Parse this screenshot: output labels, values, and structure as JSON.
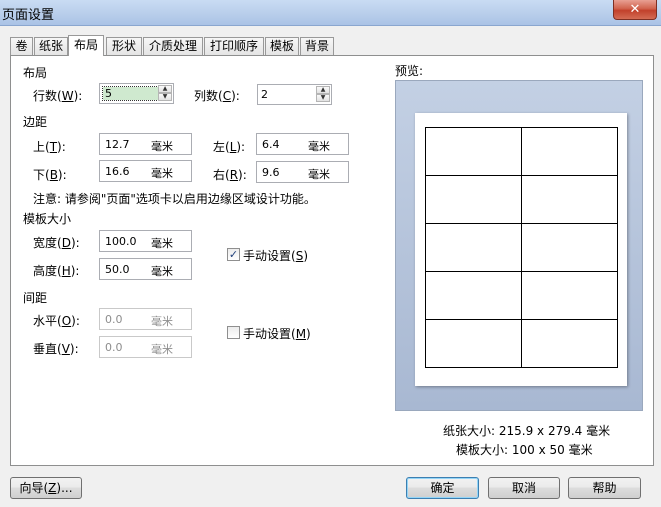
{
  "window": {
    "title": "页面设置",
    "close_glyph": "✕"
  },
  "tabs": [
    "卷",
    "纸张",
    "布局",
    "形状",
    "介质处理",
    "打印顺序",
    "模板",
    "背景"
  ],
  "layout_section": {
    "label": "布局",
    "rows_label": "行数(",
    "rows_key": "W",
    "rows_suffix": "):",
    "rows_value": "5",
    "cols_label": "列数(",
    "cols_key": "C",
    "cols_suffix": "):",
    "cols_value": "2"
  },
  "margin_section": {
    "label": "边距",
    "top_label": "上(",
    "top_key": "T",
    "top_suffix": "):",
    "top_value": "12.7",
    "top_unit": "毫米",
    "left_label": "左(",
    "left_key": "L",
    "left_suffix": "):",
    "left_value": "6.4",
    "left_unit": "毫米",
    "bottom_label": "下(",
    "bottom_key": "B",
    "bottom_suffix": "):",
    "bottom_value": "16.6",
    "bottom_unit": "毫米",
    "right_label": "右(",
    "right_key": "R",
    "right_suffix": "):",
    "right_value": "9.6",
    "right_unit": "毫米",
    "note": "注意: 请参阅\"页面\"选项卡以启用边缘区域设计功能。"
  },
  "template_size_section": {
    "label": "模板大小",
    "width_label": "宽度(",
    "width_key": "D",
    "width_suffix": "):",
    "width_value": "100.0",
    "width_unit": "毫米",
    "height_label": "高度(",
    "height_key": "H",
    "height_suffix": "):",
    "height_value": "50.0",
    "height_unit": "毫米",
    "manual_label": "手动设置(",
    "manual_key": "S",
    "manual_suffix": ")",
    "manual_checked": true
  },
  "spacing_section": {
    "label": "间距",
    "horizontal_label": "水平(",
    "horizontal_key": "O",
    "horizontal_suffix": "):",
    "horizontal_value": "0.0",
    "horizontal_unit": "毫米",
    "vertical_label": "垂直(",
    "vertical_key": "V",
    "vertical_suffix": "):",
    "vertical_value": "0.0",
    "vertical_unit": "毫米",
    "manual_label": "手动设置(",
    "manual_key": "M",
    "manual_suffix": ")",
    "manual_checked": false
  },
  "preview": {
    "label": "预览:",
    "rows": 5,
    "cols": 2,
    "paper_size_text": "纸张大小: 215.9 x 279.4 毫米",
    "template_size_text": "模板大小: 100 x 50 毫米"
  },
  "footer": {
    "wizard_label": "向导(",
    "wizard_key": "Z",
    "wizard_suffix": ")...",
    "ok_label": "确定",
    "cancel_label": "取消",
    "help_label": "帮助"
  }
}
